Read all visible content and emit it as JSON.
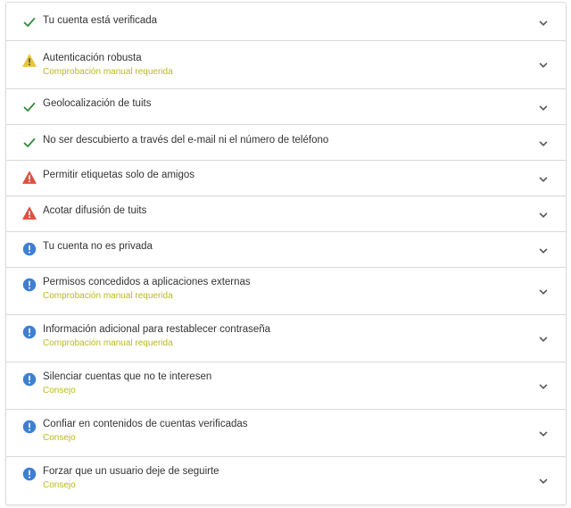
{
  "colors": {
    "check": "#2e8b3a",
    "warning": "#e8c43a",
    "danger": "#e0513f",
    "info": "#3d7fd4",
    "subtitle": "#b9b91f"
  },
  "items": [
    {
      "status": "check",
      "icon": "check-icon",
      "title": "Tu cuenta está verificada",
      "subtitle": ""
    },
    {
      "status": "warning",
      "icon": "warning-triangle-icon",
      "title": "Autenticación robusta",
      "subtitle": "Comprobación manual requerida"
    },
    {
      "status": "check",
      "icon": "check-icon",
      "title": "Geolocalización de tuits",
      "subtitle": ""
    },
    {
      "status": "check",
      "icon": "check-icon",
      "title": "No ser descubierto a través del e-mail ni el número de teléfono",
      "subtitle": ""
    },
    {
      "status": "danger",
      "icon": "alert-triangle-icon",
      "title": "Permitir etiquetas solo de amigos",
      "subtitle": ""
    },
    {
      "status": "danger",
      "icon": "alert-triangle-icon",
      "title": "Acotar difusión de tuits",
      "subtitle": ""
    },
    {
      "status": "info",
      "icon": "info-circle-icon",
      "title": "Tu cuenta no es privada",
      "subtitle": ""
    },
    {
      "status": "info",
      "icon": "info-circle-icon",
      "title": "Permisos concedidos a aplicaciones externas",
      "subtitle": "Comprobación manual requerida"
    },
    {
      "status": "info",
      "icon": "info-circle-icon",
      "title": "Información adicional para restablecer contraseña",
      "subtitle": "Comprobación manual requerida"
    },
    {
      "status": "info",
      "icon": "info-circle-icon",
      "title": "Silenciar cuentas que no te interesen",
      "subtitle": "Consejo"
    },
    {
      "status": "info",
      "icon": "info-circle-icon",
      "title": "Confiar en contenidos de cuentas verificadas",
      "subtitle": "Consejo"
    },
    {
      "status": "info",
      "icon": "info-circle-icon",
      "title": "Forzar que un usuario deje de seguirte",
      "subtitle": "Consejo"
    }
  ]
}
